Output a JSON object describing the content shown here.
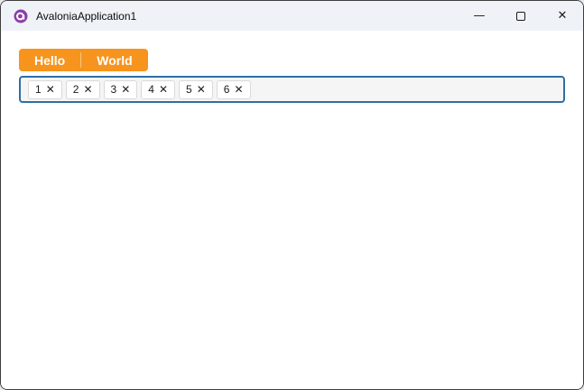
{
  "window": {
    "title": "AvaloniaApplication1",
    "titlebar_bg": "#eff3f8",
    "border_color": "#3d3d3d",
    "controls": {
      "minimize_glyph": "—",
      "close_glyph": "✕"
    }
  },
  "toolbar": {
    "hello_label": "Hello",
    "world_label": "World",
    "accent_color": "#f7941d"
  },
  "chips": {
    "items": [
      {
        "label": "1"
      },
      {
        "label": "2"
      },
      {
        "label": "3"
      },
      {
        "label": "4"
      },
      {
        "label": "5"
      },
      {
        "label": "6"
      }
    ],
    "remove_glyph": "✕",
    "focus_border_color": "#2e6fa4"
  }
}
